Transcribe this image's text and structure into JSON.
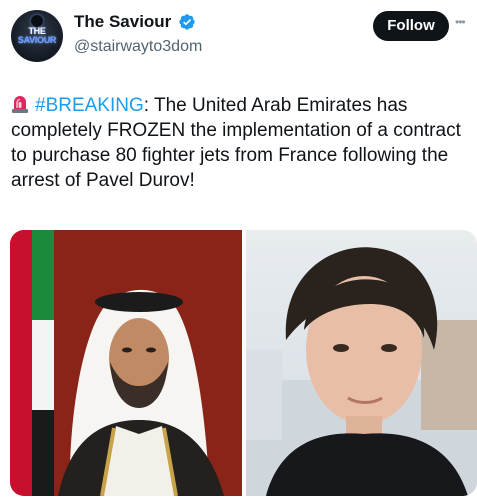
{
  "author": {
    "display_name": "The Saviour",
    "handle": "@stairwayto3dom",
    "avatar_text": [
      "THE",
      "SAVIOUR"
    ],
    "verified": true,
    "verified_color": "#1d9bf0"
  },
  "actions": {
    "follow_label": "Follow",
    "more_icon": "more-dots-icon"
  },
  "tweet": {
    "emoji": "siren-emoji",
    "hashtag": "#BREAKING",
    "hashtag_color": "#1d9bf0",
    "text_after_hashtag": ": The United Arab Emirates has completely FROZEN the implementation of a contract to purchase 80 fighter jets from France following the arrest of Pavel Durov!"
  },
  "media": {
    "images": [
      {
        "description_icon": "man-in-ghutra-with-uae-flag-photo"
      },
      {
        "description_icon": "man-in-black-shirt-portrait-photo"
      }
    ]
  }
}
